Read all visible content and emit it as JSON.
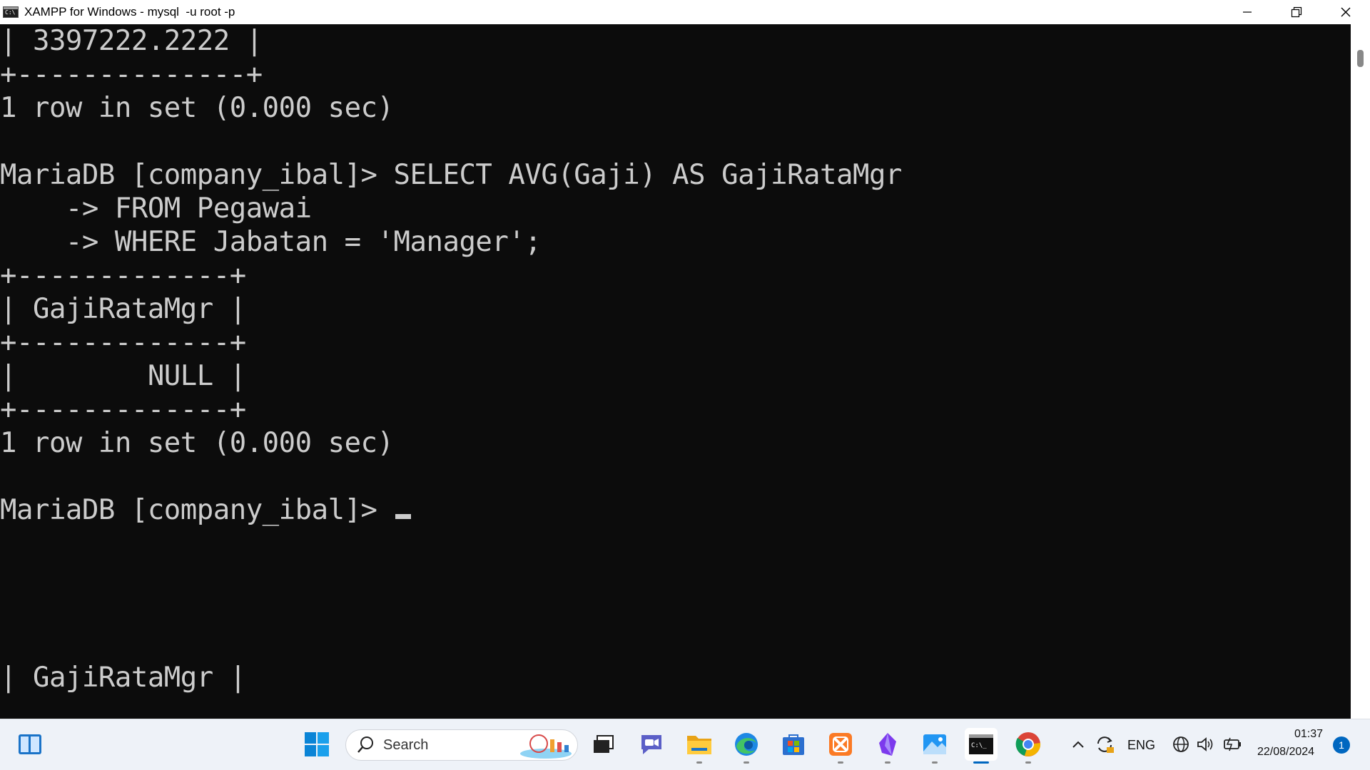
{
  "window": {
    "title": "XAMPP for Windows - mysql  -u root -p"
  },
  "console": {
    "lines": [
      "| 3397222.2222 |",
      "+--------------+",
      "1 row in set (0.000 sec)",
      "",
      "MariaDB [company_ibal]> SELECT AVG(Gaji) AS GajiRataMgr",
      "    -> FROM Pegawai",
      "    -> WHERE Jabatan = 'Manager';",
      "+-------------+",
      "| GajiRataMgr |",
      "+-------------+",
      "|        NULL |",
      "+-------------+",
      "1 row in set (0.000 sec)",
      "",
      "MariaDB [company_ibal]> "
    ],
    "ghost_line": "| GajiRataMgr |"
  },
  "taskbar": {
    "search_label": "Search",
    "language": "ENG",
    "time": "01:37",
    "date": "22/08/2024",
    "notification_count": "1",
    "icons": [
      "windows-start-icon",
      "search-icon",
      "task-view-icon",
      "meet-icon",
      "file-explorer-icon",
      "edge-icon",
      "microsoft-store-icon",
      "xampp-icon",
      "obsidian-icon",
      "photos-icon",
      "terminal-icon",
      "chrome-icon"
    ]
  },
  "colors": {
    "console_bg": "#0c0c0c",
    "console_fg": "#cccccc",
    "taskbar_bg": "#eef2f8",
    "accent": "#0067c0"
  }
}
